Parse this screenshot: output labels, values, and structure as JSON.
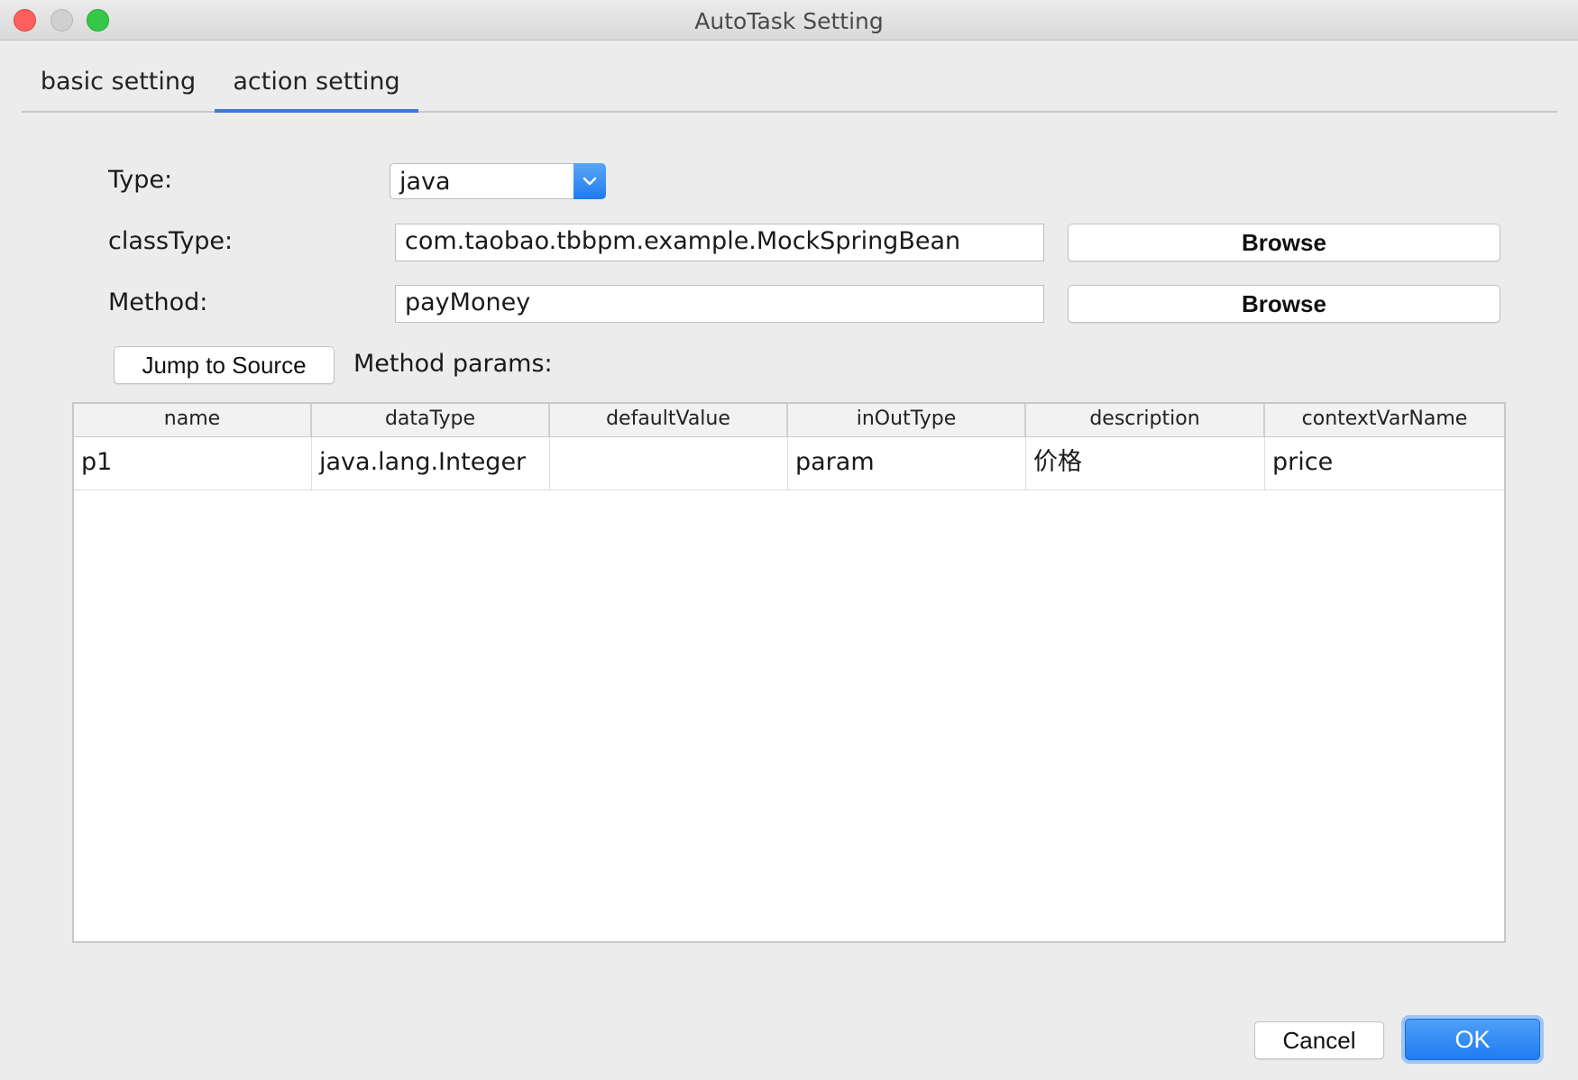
{
  "window": {
    "title": "AutoTask Setting"
  },
  "tabs": [
    {
      "label": "basic setting"
    },
    {
      "label": "action setting"
    }
  ],
  "form": {
    "type_label": "Type:",
    "type_value": "java",
    "classtype_label": "classType:",
    "classtype_value": "com.taobao.tbbpm.example.MockSpringBean",
    "method_label": "Method:",
    "method_value": "payMoney",
    "browse_label": "Browse",
    "jump_label": "Jump to Source",
    "params_label": "Method params:"
  },
  "table": {
    "columns": [
      "name",
      "dataType",
      "defaultValue",
      "inOutType",
      "description",
      "contextVarName"
    ],
    "rows": [
      [
        "p1",
        "java.lang.Integer",
        "",
        "param",
        "价格",
        "price"
      ]
    ]
  },
  "footer": {
    "cancel_label": "Cancel",
    "ok_label": "OK"
  },
  "colors": {
    "accent": "#1f7cf0",
    "tab_underline": "#3a7bd5",
    "close": "#fc605c",
    "maximize": "#34c748"
  }
}
